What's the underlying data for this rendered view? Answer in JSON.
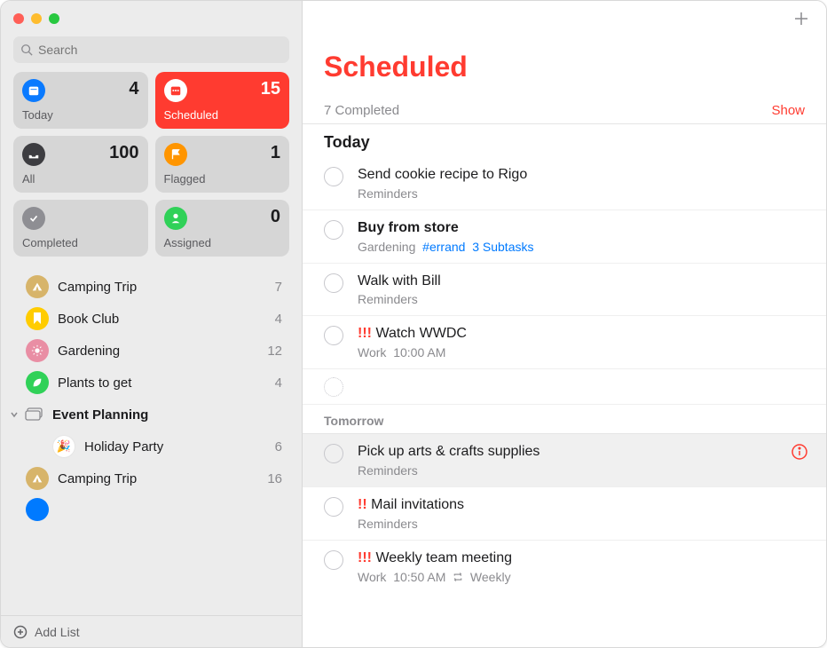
{
  "search": {
    "placeholder": "Search"
  },
  "smart": {
    "today": {
      "label": "Today",
      "count": 4,
      "color": "#0a7aff"
    },
    "scheduled": {
      "label": "Scheduled",
      "count": 15,
      "color": "#ff3b30"
    },
    "all": {
      "label": "All",
      "count": 100,
      "color": "#3d3d41"
    },
    "flagged": {
      "label": "Flagged",
      "count": 1,
      "color": "#ff9500"
    },
    "completed": {
      "label": "Completed",
      "count": "",
      "color": "#8e8e93"
    },
    "assigned": {
      "label": "Assigned",
      "count": 0,
      "color": "#30d158"
    }
  },
  "lists": {
    "campingTrip": {
      "name": "Camping Trip",
      "count": 7,
      "color": "#d7b46a"
    },
    "bookClub": {
      "name": "Book Club",
      "count": 4,
      "color": "#ffcc00"
    },
    "gardening": {
      "name": "Gardening",
      "count": 12,
      "color": "#e98ea4"
    },
    "plantsToGet": {
      "name": "Plants to get",
      "count": 4,
      "color": "#30d158"
    },
    "group": {
      "name": "Event Planning"
    },
    "holidayParty": {
      "name": "Holiday Party",
      "count": 6,
      "emoji": "🎉"
    },
    "campingTrip2": {
      "name": "Camping Trip",
      "count": 16,
      "color": "#d7b46a"
    }
  },
  "footer": {
    "addList": "Add List"
  },
  "main": {
    "title": "Scheduled",
    "completedSummary": "7 Completed",
    "showLabel": "Show",
    "sections": {
      "today": "Today",
      "tomorrow": "Tomorrow"
    }
  },
  "tasks": {
    "t1": {
      "title": "Send cookie recipe to Rigo",
      "list": "Reminders"
    },
    "t2": {
      "title": "Buy from store",
      "list": "Gardening",
      "tag": "#errand",
      "subtasks": "3 Subtasks"
    },
    "t3": {
      "title": "Walk with Bill",
      "list": "Reminders"
    },
    "t4": {
      "priority": "!!!",
      "title": "Watch WWDC",
      "list": "Work",
      "time": "10:00 AM"
    },
    "t5": {
      "title": "Pick up arts & crafts supplies",
      "list": "Reminders"
    },
    "t6": {
      "priority": "!!",
      "title": "Mail invitations",
      "list": "Reminders"
    },
    "t7": {
      "priority": "!!!",
      "title": "Weekly team meeting",
      "list": "Work",
      "time": "10:50 AM",
      "repeat": "Weekly"
    }
  }
}
